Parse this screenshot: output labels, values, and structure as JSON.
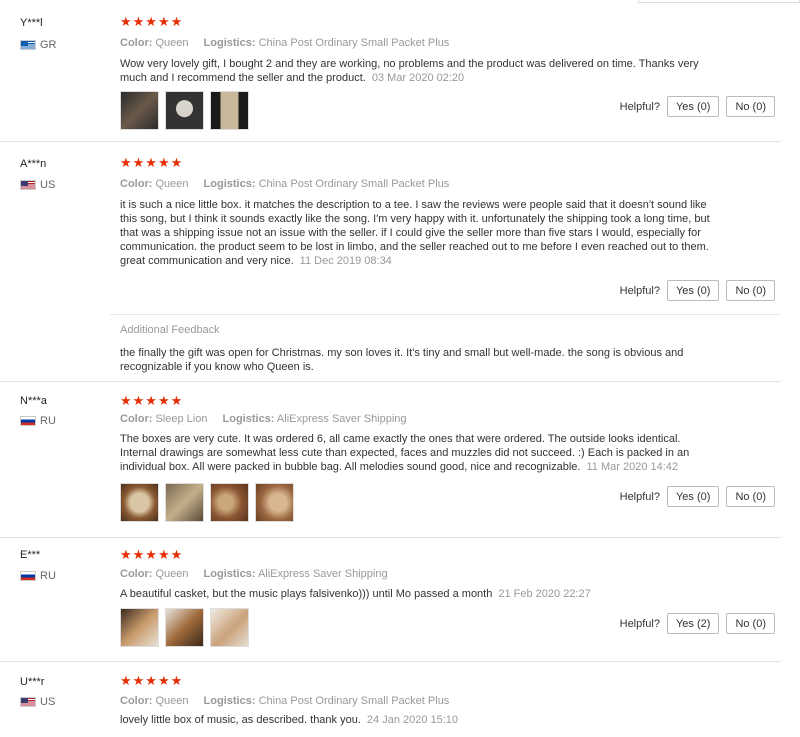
{
  "reviews": [
    {
      "user": "Y***l",
      "country": "GR",
      "stars": "★★★★★",
      "color_label": "Color:",
      "color_value": "Queen",
      "logistics_label": "Logistics:",
      "logistics_value": "China Post Ordinary Small Packet Plus",
      "text": "Wow very lovely gift, I bought 2 and they are working, no problems and the product was delivered on time. Thanks very much and I recommend the seller and the product.",
      "date": "03 Mar 2020 02:20",
      "helpful_label": "Helpful?",
      "yes_label": "Yes (0)",
      "no_label": "No (0)"
    },
    {
      "user": "A***n",
      "country": "US",
      "stars": "★★★★★",
      "color_label": "Color:",
      "color_value": "Queen",
      "logistics_label": "Logistics:",
      "logistics_value": "China Post Ordinary Small Packet Plus",
      "text": "it is such a nice little box. it matches the description to a tee. I saw the reviews were people said that it doesn't sound like this song, but I think it sounds exactly like the song. I'm very happy with it. unfortunately the shipping took a long time, but that was a shipping issue not an issue with the seller. if I could give the seller more than five stars I would, especially for communication. the product seem to be lost in limbo, and the seller reached out to me before I even reached out to them. great communication and very nice.",
      "date": "11 Dec 2019 08:34",
      "helpful_label": "Helpful?",
      "yes_label": "Yes (0)",
      "no_label": "No (0)",
      "additional_title": "Additional Feedback",
      "additional_text": "the finally the gift was open for Christmas. my son loves it. It's tiny and small but well-made. the song is obvious and recognizable if you know who Queen is."
    },
    {
      "user": "N***a",
      "country": "RU",
      "stars": "★★★★★",
      "color_label": "Color:",
      "color_value": "Sleep Lion",
      "logistics_label": "Logistics:",
      "logistics_value": "AliExpress Saver Shipping",
      "text": "The boxes are very cute. It was ordered 6, all came exactly the ones that were ordered. The outside looks identical. Internal drawings are somewhat less cute than expected, faces and muzzles did not succeed. :) Each is packed in an individual box. All were packed in bubble bag. All melodies sound good, nice and recognizable.",
      "date": "11 Mar 2020 14:42",
      "helpful_label": "Helpful?",
      "yes_label": "Yes (0)",
      "no_label": "No (0)"
    },
    {
      "user": "E***",
      "country": "RU",
      "stars": "★★★★★",
      "color_label": "Color:",
      "color_value": "Queen",
      "logistics_label": "Logistics:",
      "logistics_value": "AliExpress Saver Shipping",
      "text": "A beautiful casket, but the music plays falsivenko))) until Mo passed a month",
      "date": "21 Feb 2020 22:27",
      "helpful_label": "Helpful?",
      "yes_label": "Yes (2)",
      "no_label": "No (0)"
    },
    {
      "user": "U***r",
      "country": "US",
      "stars": "★★★★★",
      "color_label": "Color:",
      "color_value": "Queen",
      "logistics_label": "Logistics:",
      "logistics_value": "China Post Ordinary Small Packet Plus",
      "text": "lovely little box of music, as described. thank you.",
      "date": "24 Jan 2020 15:10"
    }
  ],
  "colors": {
    "star": "#e62e04"
  }
}
